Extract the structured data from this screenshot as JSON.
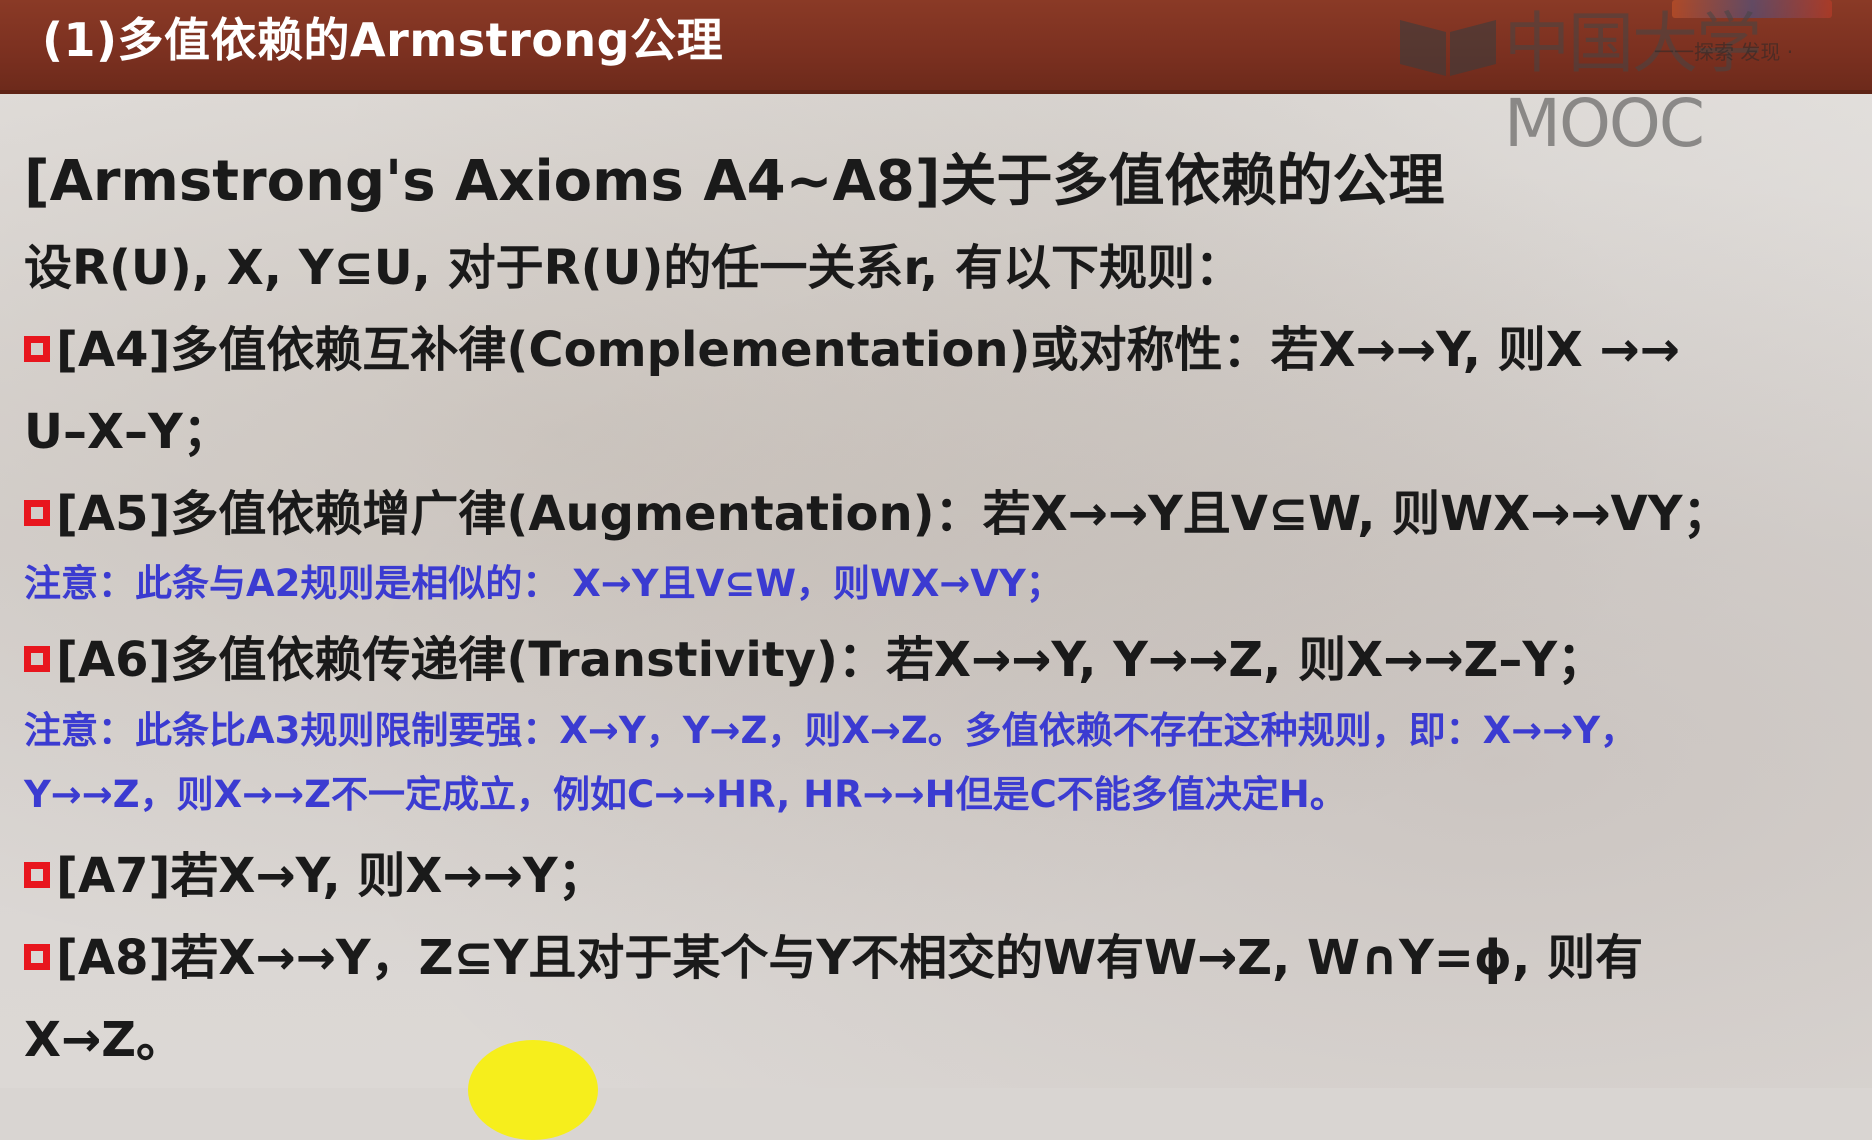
{
  "header": {
    "title": "(1)多值依赖的Armstrong公理",
    "logo_text": "中国大学MOOC",
    "logo_subtext": "一一探索 发现 ·"
  },
  "slide": {
    "heading": "[Armstrong's Axioms A4~A8]关于多值依赖的公理",
    "intro": "设R(U), X, Y⊆U, 对于R(U)的任一关系r, 有以下规则：",
    "rules": {
      "a4_line1": "[A4]多值依赖互补律(Complementation)或对称性：若X→→Y, 则X  →→",
      "a4_line2": "U–X–Y；",
      "a5": "[A5]多值依赖增广律(Augmentation)：若X→→Y且V⊆W, 则WX→→VY；",
      "a5_note": "注意：此条与A2规则是相似的： X→Y且V⊆W，则WX→VY；",
      "a6": "[A6]多值依赖传递律(Transtivity)：若X→→Y,  Y→→Z, 则X→→Z–Y；",
      "a6_note_line1": "注意：此条比A3规则限制要强：X→Y，Y→Z，则X→Z。多值依赖不存在这种规则，即：X→→Y，",
      "a6_note_line2": "Y→→Z，则X→→Z不一定成立，例如C→→HR, HR→→H但是C不能多值决定H。",
      "a7": "[A7]若X→Y,  则X→→Y；",
      "a8_line1": "[A8]若X→→Y，Z⊆Y且对于某个与Y不相交的W有W→Z,  W∩Y=ϕ,  则有",
      "a8_line2": "X→Z。"
    }
  },
  "colors": {
    "header_bg": "#7b3020",
    "bullet": "#e8161e",
    "note_text": "#3b3bd1",
    "body_text": "#1a1a1a",
    "cursor_highlight": "#f6ee1c"
  },
  "icons": [
    "mooc-book-logo-icon",
    "red-square-bullet-icon",
    "mouse-cursor-highlight"
  ]
}
